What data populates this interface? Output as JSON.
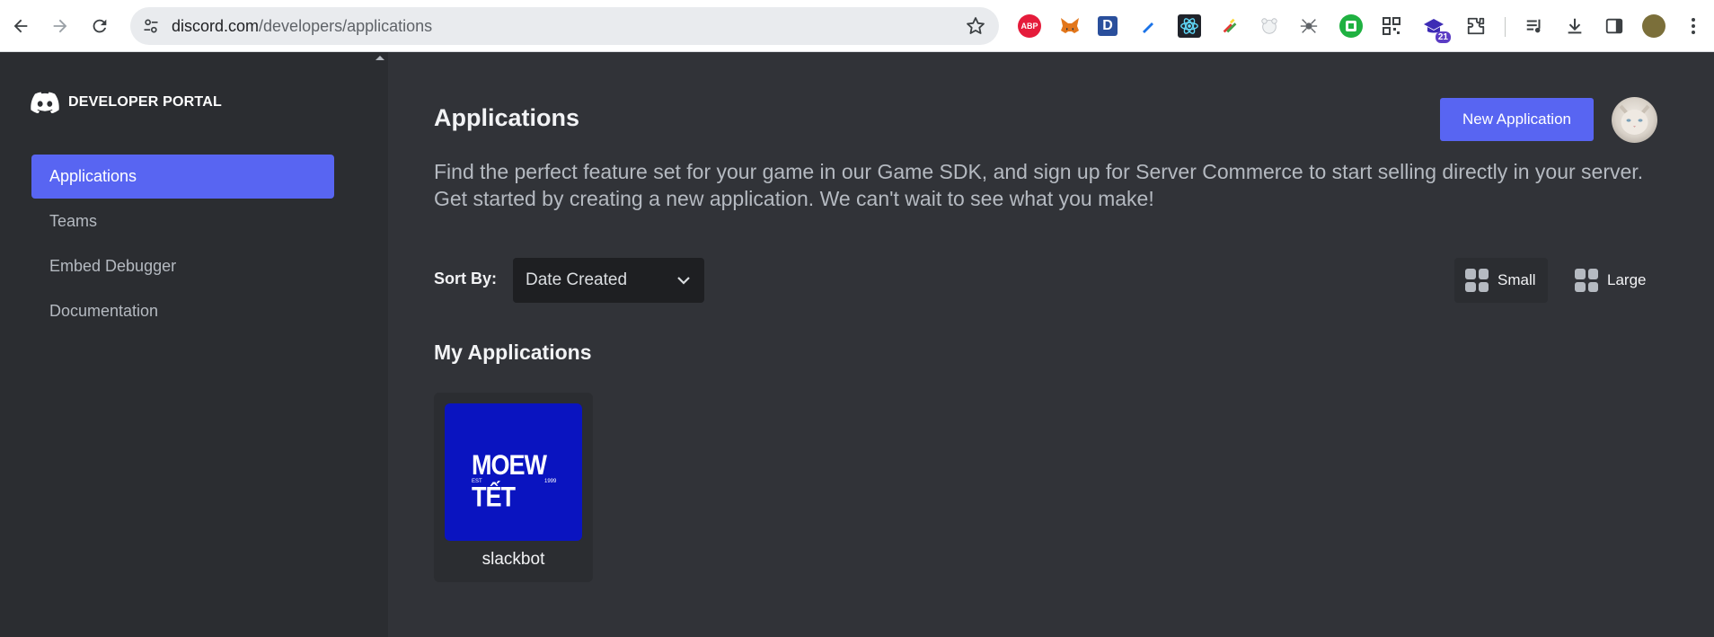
{
  "browser": {
    "url_domain": "discord.com",
    "url_path": "/developers/applications",
    "extensions": [
      "abp-icon",
      "metamask-fox-icon",
      "d-extension-icon",
      "pen-icon",
      "react-devtools-icon",
      "color-picker-icon",
      "bear-icon",
      "spider-icon",
      "green-square-icon",
      "qr-code-icon",
      "graduation-cap-icon",
      "puzzle-icon"
    ],
    "ext_abp_label": "ABP",
    "ext_d_label": "D",
    "ext_badge": "21"
  },
  "sidebar": {
    "brand": "DEVELOPER PORTAL",
    "items": [
      {
        "label": "Applications",
        "active": true
      },
      {
        "label": "Teams",
        "active": false
      },
      {
        "label": "Embed Debugger",
        "active": false
      },
      {
        "label": "Documentation",
        "active": false
      }
    ]
  },
  "main": {
    "title": "Applications",
    "new_button": "New Application",
    "description": "Find the perfect feature set for your game in our Game SDK, and sign up for Server Commerce to start selling directly in your server. Get started by creating a new application. We can't wait to see what you make!",
    "sort_label": "Sort By:",
    "sort_value": "Date Created",
    "view_small": "Small",
    "view_large": "Large",
    "section_title": "My Applications",
    "apps": [
      {
        "name": "slackbot",
        "logo_text": "MOEW TẾT",
        "logo_est": "EST",
        "logo_year": "1999"
      }
    ]
  },
  "colors": {
    "accent": "#5865f2",
    "sidebar_bg": "#2b2d31",
    "main_bg": "#313338",
    "app_icon_bg": "#0a14c0"
  }
}
